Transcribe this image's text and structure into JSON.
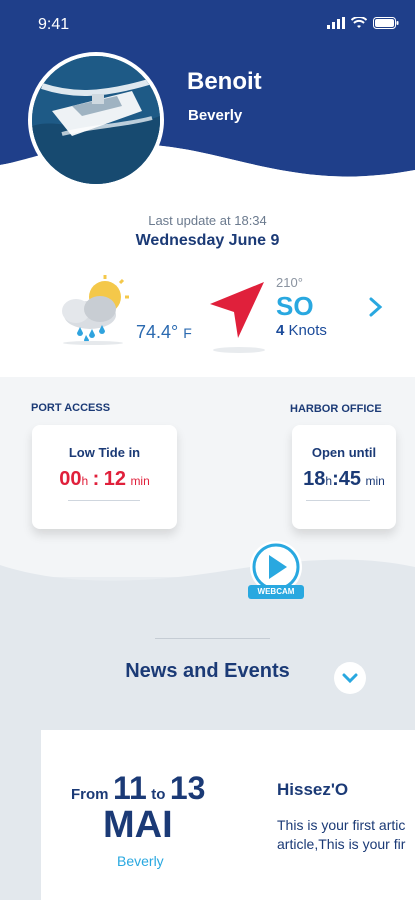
{
  "status_bar": {
    "time": "9:41"
  },
  "profile": {
    "name": "Benoit",
    "location": "Beverly"
  },
  "weather": {
    "last_update": "Last update at 18:34",
    "date": "Wednesday June 9",
    "temperature": "74.4°",
    "temperature_unit": "F",
    "wind_degrees": "210°",
    "wind_direction": "SO",
    "wind_speed": "4",
    "wind_speed_unit": "Knots"
  },
  "port_access": {
    "label": "PORT ACCESS",
    "title": "Low Tide in",
    "hours": "00",
    "h": "h",
    "sep": ":",
    "minutes": "12",
    "min": "min"
  },
  "harbor_office": {
    "label": "HARBOR OFFICE",
    "title": "Open until",
    "hours": "18",
    "h": "h",
    "sep": ":",
    "minutes": "45",
    "min": "min"
  },
  "webcam": {
    "label": "WEBCAM"
  },
  "news": {
    "heading": "News and Events",
    "event": {
      "from": "From",
      "start_day": "11",
      "to": "to",
      "end_day": "13",
      "month": "MAI",
      "location": "Beverly",
      "title": "Hissez'O",
      "body_line1": "This is your first artic",
      "body_line2": "article,This is your fir"
    }
  },
  "colors": {
    "navy": "#1b3a76",
    "accent": "#29a8e0",
    "alert": "#e0203b"
  }
}
